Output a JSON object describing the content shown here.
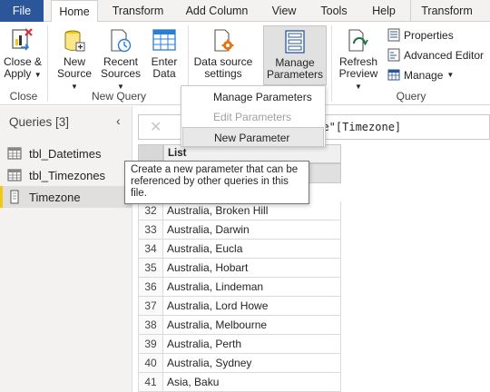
{
  "tabs": [
    {
      "label": "File"
    },
    {
      "label": "Home"
    },
    {
      "label": "Transform"
    },
    {
      "label": "Add Column"
    },
    {
      "label": "View"
    },
    {
      "label": "Tools"
    },
    {
      "label": "Help"
    },
    {
      "label": "Transform"
    }
  ],
  "ribbon": {
    "close_apply": {
      "line1": "Close &",
      "line2": "Apply"
    },
    "new_source": {
      "line1": "New",
      "line2": "Source"
    },
    "recent_sources": {
      "line1": "Recent",
      "line2": "Sources"
    },
    "enter_data": {
      "line1": "Enter",
      "line2": "Data"
    },
    "data_source_settings": {
      "line1": "Data source",
      "line2": "settings"
    },
    "manage_parameters": {
      "line1": "Manage",
      "line2": "Parameters"
    },
    "refresh_preview": {
      "line1": "Refresh",
      "line2": "Preview"
    },
    "properties": "Properties",
    "advanced_editor": "Advanced Editor",
    "manage": "Manage",
    "groups": {
      "close": "Close",
      "new_query": "New Query",
      "query": "Query"
    }
  },
  "menu": {
    "items": [
      {
        "label": "Manage Parameters",
        "state": "normal"
      },
      {
        "label": "Edit Parameters",
        "state": "disabled"
      },
      {
        "label": "New Parameter",
        "state": "hover"
      }
    ]
  },
  "tooltip": {
    "text": "Create a new parameter that can be referenced by other queries in this file."
  },
  "queries": {
    "title": "Queries [3]",
    "items": [
      {
        "name": "tbl_Datetimes",
        "icon": "table-icon",
        "selected": false
      },
      {
        "name": "tbl_Timezones",
        "icon": "table-icon",
        "selected": false
      },
      {
        "name": "Timezone",
        "icon": "parameter-icon",
        "selected": true
      }
    ]
  },
  "formula": {
    "visible_text": "ype\"[Timezone]"
  },
  "grid": {
    "column_header": "List",
    "rows": [
      {
        "index": "32",
        "value": "Australia, Broken Hill"
      },
      {
        "index": "33",
        "value": "Australia, Darwin"
      },
      {
        "index": "34",
        "value": "Australia, Eucla"
      },
      {
        "index": "35",
        "value": "Australia, Hobart"
      },
      {
        "index": "36",
        "value": "Australia, Lindeman"
      },
      {
        "index": "37",
        "value": "Australia, Lord Howe"
      },
      {
        "index": "38",
        "value": "Australia, Melbourne"
      },
      {
        "index": "39",
        "value": "Australia, Perth"
      },
      {
        "index": "40",
        "value": "Australia, Sydney"
      },
      {
        "index": "41",
        "value": "Asia, Baku"
      }
    ]
  },
  "colors": {
    "file_tab": "#2b579a",
    "selected_marker": "#f2c811",
    "excel_green": "#217346"
  }
}
